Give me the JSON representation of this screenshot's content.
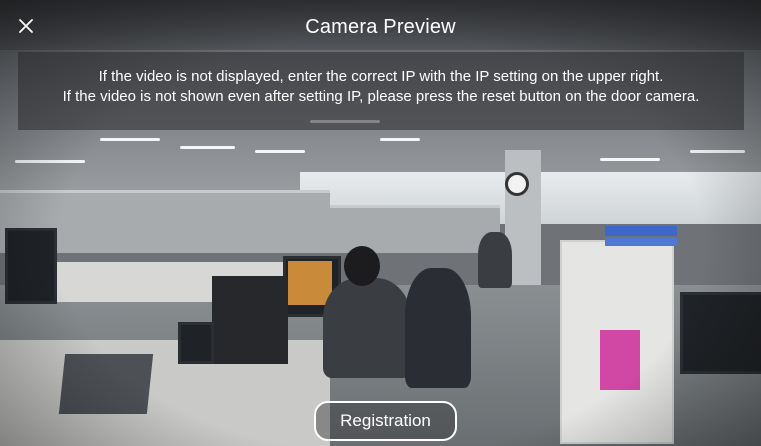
{
  "header": {
    "title": "Camera Preview",
    "close_icon": "close-icon"
  },
  "notice": {
    "line1": "If the video is not displayed, enter the correct IP with the IP setting on the upper right.",
    "line2": "If the video is not shown even after setting IP, please press the reset button on the door camera."
  },
  "actions": {
    "registration_label": "Registration"
  },
  "colors": {
    "overlay_text": "#ffffff",
    "button_border": "#ffffff"
  }
}
